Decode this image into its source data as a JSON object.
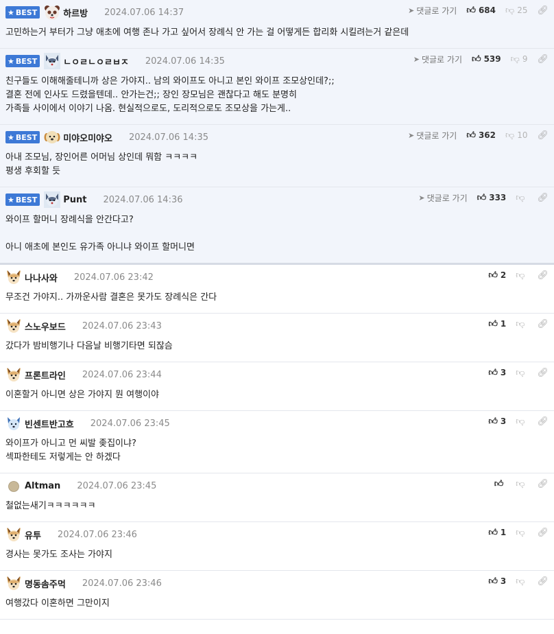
{
  "goto_label": "댓글로 가기",
  "best_label": "BEST",
  "comments": [
    {
      "best": true,
      "avatar": "panda-bear-avatar",
      "nick": "하르방",
      "date": "2024.07.06 14:37",
      "likes": "684",
      "dislikes": "25",
      "text": "고민하는거 부터가 그냥 애초에 여행 존나 가고 싶어서 장례식 안 가는 걸 어떻게든 합리화 시킬려는거 같은데"
    },
    {
      "best": true,
      "avatar": "husky-dog-avatar",
      "nick": "ㄴㅇㄹㄴㅇㄹㅂㅈ",
      "date": "2024.07.06 14:35",
      "likes": "539",
      "dislikes": "9",
      "text": "친구들도 이해해줄테니까 상은 가야지.. 남의 와이프도 아니고 본인 와이프 조모상인데?;;\n결혼 전에 인사도 드렸을텐데.. 안가는건;; 장인 장모님은 괜찮다고 해도 분명히\n가족들 사이에서 이야기 나옴. 현실적으로도, 도리적으로도 조모상을 가는게.."
    },
    {
      "best": true,
      "avatar": "puppy-avatar",
      "nick": "미야오미야오",
      "date": "2024.07.06 14:35",
      "likes": "362",
      "dislikes": "10",
      "text": "아내 조모님, 장인어른 어머님 상인데 뭐함 ㅋㅋㅋㅋ\n평생 후회할 듯"
    },
    {
      "best": true,
      "avatar": "husky-dog-avatar",
      "nick": "Punt",
      "date": "2024.07.06 14:36",
      "likes": "333",
      "dislikes": "",
      "text": "와이프 할머니 장례식을 안간다고?\n\n아니 애초에 본인도 유가족 아니냐 와이프 할머니면"
    },
    {
      "best": false,
      "avatar": "fox-dog-avatar",
      "nick": "나나사와",
      "date": "2024.07.06 23:42",
      "likes": "2",
      "dislikes": "",
      "text": "무조건 가야지.. 가까운사람 결혼은 못가도 장례식은 간다"
    },
    {
      "best": false,
      "avatar": "fox-dog-avatar",
      "nick": "스노우보드",
      "date": "2024.07.06 23:43",
      "likes": "1",
      "dislikes": "",
      "text": "갔다가 밤비행기나 다음날 비행기타면 되잖슴"
    },
    {
      "best": false,
      "avatar": "fox-dog-avatar",
      "nick": "프론트라인",
      "date": "2024.07.06 23:44",
      "likes": "3",
      "dislikes": "",
      "text": "이혼할거 아니면 상은 가야지 뭔 여행이야"
    },
    {
      "best": false,
      "avatar": "blue-dog-avatar",
      "nick": "빈센트반고흐",
      "date": "2024.07.06 23:45",
      "likes": "3",
      "dislikes": "",
      "text": "와이프가 아니고 먼 씨발 좆집이냐?\n섹파한테도 저렇게는 안 하겠다"
    },
    {
      "best": false,
      "avatar": "default-circle-avatar",
      "nick": "Altman",
      "date": "2024.07.06 23:45",
      "likes": "",
      "dislikes": "",
      "text": "철없는새기ㅋㅋㅋㅋㅋㅋ"
    },
    {
      "best": false,
      "avatar": "fox-dog-avatar",
      "nick": "유투",
      "date": "2024.07.06 23:46",
      "likes": "1",
      "dislikes": "",
      "text": "경사는 못가도 조사는 가야지"
    },
    {
      "best": false,
      "avatar": "fox-dog-avatar",
      "nick": "명동솜주먹",
      "date": "2024.07.06 23:46",
      "likes": "3",
      "dislikes": "",
      "text": "여행갔다 이혼하면 그만이지"
    }
  ]
}
